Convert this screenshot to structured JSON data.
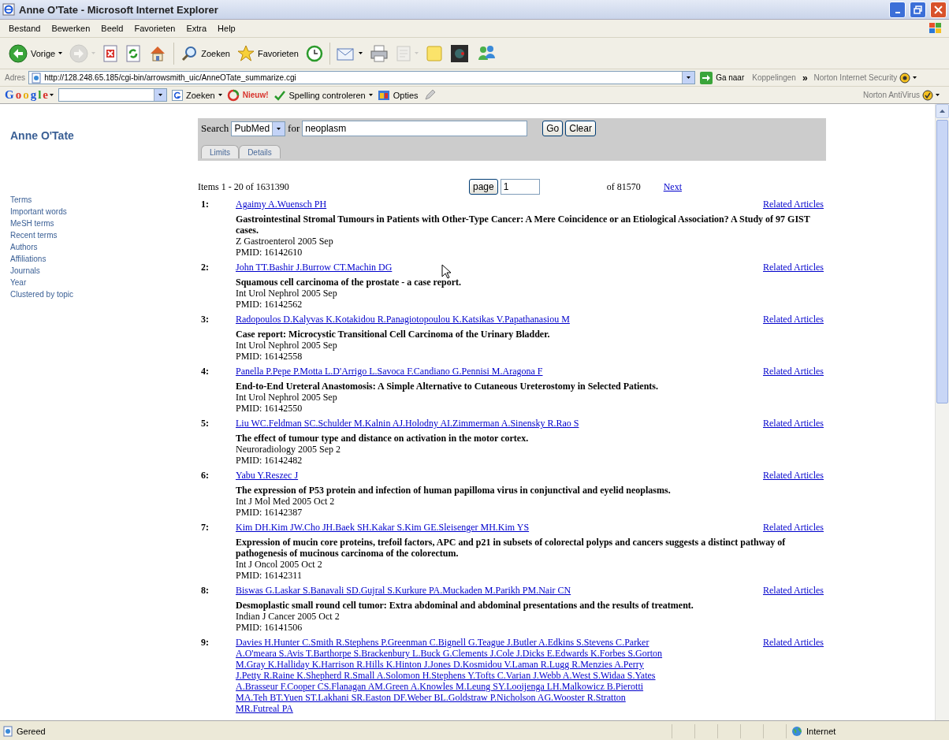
{
  "window": {
    "title": "Anne O'Tate - Microsoft Internet Explorer"
  },
  "menu": [
    "Bestand",
    "Bewerken",
    "Beeld",
    "Favorieten",
    "Extra",
    "Help"
  ],
  "toolbar": {
    "groups": [
      [
        {
          "label": "Vorige",
          "dropdown": true,
          "disabled": false
        },
        {
          "dropdown": true,
          "disabled": true
        },
        {
          "dropdown": false,
          "disabled": false
        },
        {
          "dropdown": false,
          "disabled": false
        },
        {
          "dropdown": false,
          "disabled": false
        }
      ],
      [
        {
          "label": "Zoeken",
          "dropdown": false,
          "disabled": false
        },
        {
          "label": "Favorieten",
          "dropdown": false,
          "disabled": false
        },
        {
          "dropdown": false,
          "disabled": false
        }
      ],
      [
        {
          "dropdown": true,
          "disabled": false
        },
        {
          "dropdown": false,
          "disabled": false
        },
        {
          "dropdown": true,
          "disabled": true
        },
        {
          "dropdown": false,
          "disabled": false
        },
        {
          "dropdown": false,
          "disabled": false
        },
        {
          "dropdown": false,
          "disabled": false
        }
      ]
    ]
  },
  "address_bar": {
    "label": "Adres",
    "url": "http://128.248.65.185/cgi-bin/arrowsmith_uic/AnneOTate_summarize.cgi",
    "go": "Ga naar",
    "links": "Koppelingen",
    "more": "»",
    "norton": "Norton Internet Security"
  },
  "google_bar": {
    "logo": "Google",
    "search": "Zoeken",
    "new": "Nieuw!",
    "spelling": "Spelling controleren",
    "options": "Opties",
    "antivirus": "Norton AntiVirus"
  },
  "sidebar": {
    "title": "Anne O'Tate",
    "items": [
      "Terms",
      "Important words",
      "MeSH terms",
      "Recent terms",
      "Authors",
      "Affiliations",
      "Journals",
      "Year",
      "Clustered by topic"
    ]
  },
  "search": {
    "label": "Search",
    "database": "PubMed",
    "for": "for",
    "query": "neoplasm",
    "go": "Go",
    "clear": "Clear",
    "tabs": [
      "Limits",
      "Details"
    ]
  },
  "pager": {
    "items": "Items 1 - 20 of 1631390",
    "page_button": "page",
    "page": "1",
    "of": "of 81570",
    "next": "Next"
  },
  "results": [
    {
      "number": "1:",
      "authors": "Agaimy A.Wuensch PH",
      "title": "Gastrointestinal Stromal Tumours in Patients with Other-Type Cancer: A Mere Coincidence or an Etiological Association? A Study of 97 GIST cases.",
      "journal": "Z Gastroenterol 2005 Sep",
      "pmid": "PMID: 16142610",
      "related": "Related Articles"
    },
    {
      "number": "2:",
      "authors": "John TT.Bashir J.Burrow CT.Machin DG",
      "title": "Squamous cell carcinoma of the prostate - a case report.",
      "journal": "Int Urol Nephrol 2005 Sep",
      "pmid": "PMID: 16142562",
      "related": "Related Articles"
    },
    {
      "number": "3:",
      "authors": "Radopoulos D.Kalyvas K.Kotakidou R.Panagiotopoulou K.Katsikas V.Papathanasiou M",
      "title": "Case report: Microcystic Transitional Cell Carcinoma of the Urinary Bladder.",
      "journal": "Int Urol Nephrol 2005 Sep",
      "pmid": "PMID: 16142558",
      "related": "Related Articles"
    },
    {
      "number": "4:",
      "authors": "Panella P.Pepe P.Motta L.D'Arrigo L.Savoca F.Candiano G.Pennisi M.Aragona F",
      "title": "End-to-End Ureteral Anastomosis: A Simple Alternative to Cutaneous Ureterostomy in Selected Patients.",
      "journal": "Int Urol Nephrol 2005 Sep",
      "pmid": "PMID: 16142550",
      "related": "Related Articles"
    },
    {
      "number": "5:",
      "authors": "Liu WC.Feldman SC.Schulder M.Kalnin AJ.Holodny AI.Zimmerman A.Sinensky R.Rao S",
      "title": "The effect of tumour type and distance on activation in the motor cortex.",
      "journal": "Neuroradiology 2005 Sep 2",
      "pmid": "PMID: 16142482",
      "related": "Related Articles"
    },
    {
      "number": "6:",
      "authors": "Yabu Y.Reszec J",
      "title": "The expression of P53 protein and infection of human papilloma virus in conjunctival and eyelid neoplasms.",
      "journal": "Int J Mol Med 2005 Oct 2",
      "pmid": "PMID: 16142387",
      "related": "Related Articles"
    },
    {
      "number": "7:",
      "authors": "Kim DH.Kim JW.Cho JH.Baek SH.Kakar S.Kim GE.Sleisenger MH.Kim YS",
      "title": "Expression of mucin core proteins, trefoil factors, APC and p21 in subsets of colorectal polyps and cancers suggests a distinct pathway of pathogenesis of mucinous carcinoma of the colorectum.",
      "journal": "Int J Oncol 2005 Oct 2",
      "pmid": "PMID: 16142311",
      "related": "Related Articles"
    },
    {
      "number": "8:",
      "authors": "Biswas G.Laskar S.Banavali SD.Gujral S.Kurkure PA.Muckaden M.Parikh PM.Nair CN",
      "title": "Desmoplastic small round cell tumor: Extra abdominal and abdominal presentations and the results of treatment.",
      "journal": "Indian J Cancer 2005 Oct 2",
      "pmid": "PMID: 16141506",
      "related": "Related Articles"
    },
    {
      "number": "9:",
      "authors": "Davies H.Hunter C.Smith R.Stephens P.Greenman C.Bignell G.Teague J.Butler A.Edkins S.Stevens C.Parker A.O'meara S.Avis T.Barthorpe S.Brackenbury L.Buck G.Clements J.Cole J.Dicks E.Edwards K.Forbes S.Gorton M.Gray K.Halliday K.Harrison R.Hills K.Hinton J.Jones D.Kosmidou V.Laman R.Lugg R.Menzies A.Perry J.Petty R.Raine K.Shepherd R.Small A.Solomon H.Stephens Y.Tofts C.Varian J.Webb A.West S.Widaa S.Yates A.Brasseur F.Cooper CS.Flanagan AM.Green A.Knowles M.Leung SY.Looijenga LH.Malkowicz B.Pierotti MA.Teh BT.Yuen ST.Lakhani SR.Easton DF.Weber BL.Goldstraw P.Nicholson AG.Wooster R.Stratton MR.Futreal PA",
      "related": "Related Articles"
    }
  ],
  "status_bar": {
    "text": "Gereed",
    "zone": "Internet"
  }
}
